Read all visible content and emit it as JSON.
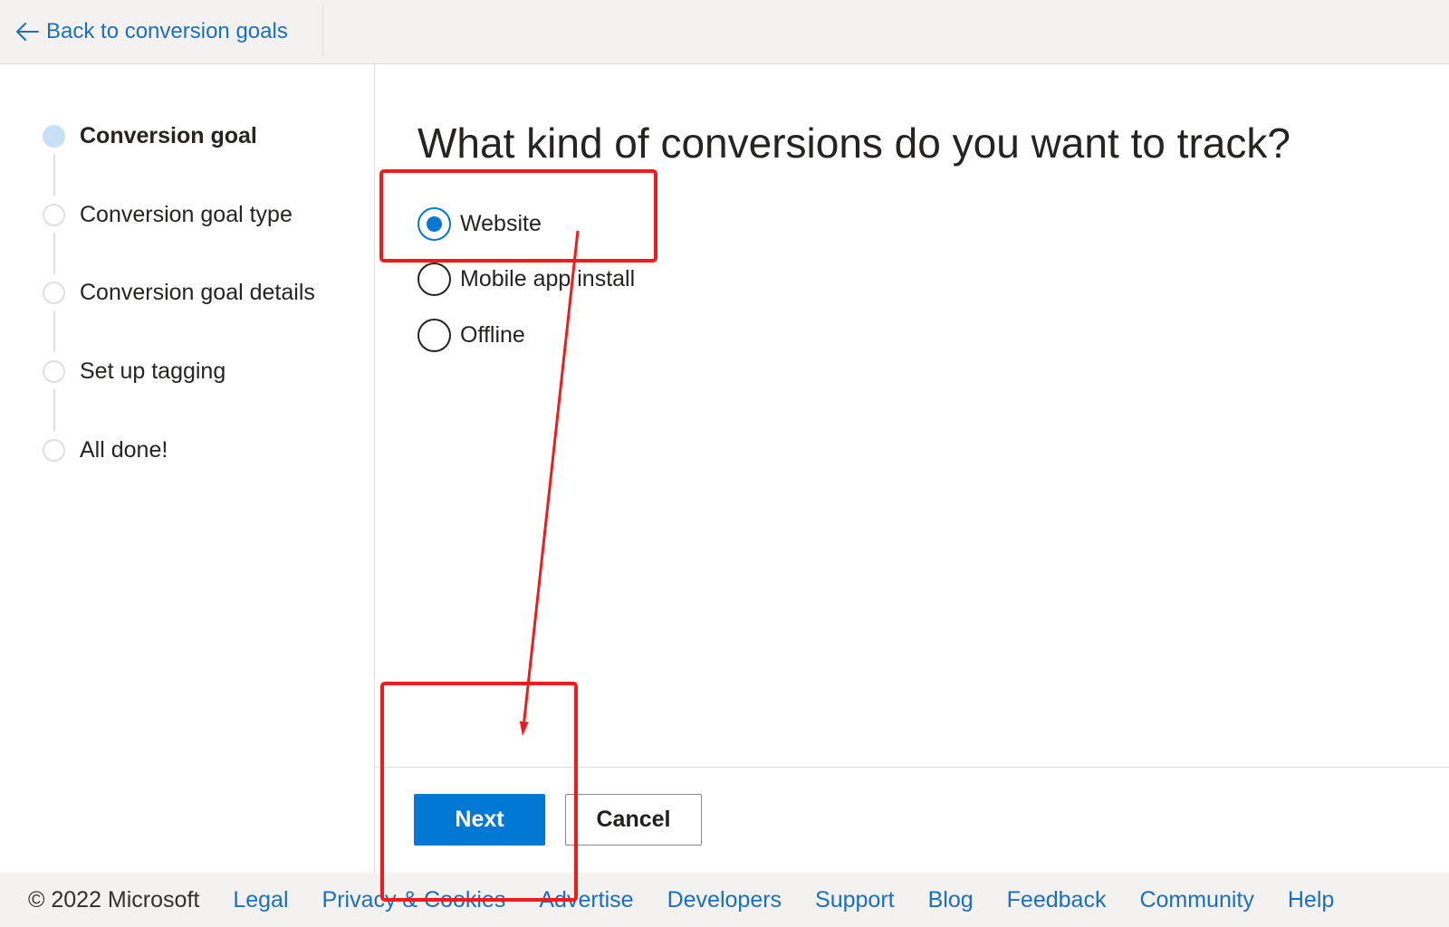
{
  "topbar": {
    "back_label": "Back to conversion goals",
    "back_icon": "arrow-left-icon"
  },
  "steps": [
    {
      "label": "Conversion goal",
      "current": true
    },
    {
      "label": "Conversion goal type",
      "current": false
    },
    {
      "label": "Conversion goal details",
      "current": false
    },
    {
      "label": "Set up tagging",
      "current": false
    },
    {
      "label": "All done!",
      "current": false
    }
  ],
  "main": {
    "heading": "What kind of conversions do you want to track?",
    "options": [
      {
        "label": "Website",
        "selected": true
      },
      {
        "label": "Mobile app install",
        "selected": false
      },
      {
        "label": "Offline",
        "selected": false
      }
    ]
  },
  "actions": {
    "next_label": "Next",
    "cancel_label": "Cancel"
  },
  "footer": {
    "copyright": "© 2022 Microsoft",
    "links": [
      "Legal",
      "Privacy & Cookies",
      "Advertise",
      "Developers",
      "Support",
      "Blog",
      "Feedback",
      "Community",
      "Help"
    ]
  },
  "colors": {
    "text": "#252423",
    "link": "#1b6ec2",
    "accent": "#0078d4",
    "step_current": "#c7e0f4",
    "divider": "#e1dfdd",
    "topbar_bg": "#f3f2f1",
    "footer_bg": "#f3f2f1",
    "radio_border": "#252423",
    "cancel_border": "#8a8886",
    "annotation": "#ee1c1c"
  }
}
